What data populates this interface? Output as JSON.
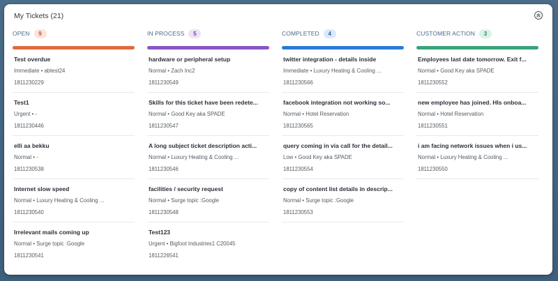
{
  "header": {
    "title": "My Tickets (21)",
    "collapse_icon": "chevron-up-circle-icon"
  },
  "colors": {
    "open": "#e06a3c",
    "in_process": "#8a55c4",
    "completed": "#2b7bd6",
    "customer_action": "#3aa37a"
  },
  "columns": [
    {
      "label": "OPEN",
      "count": "9",
      "tickets": [
        {
          "subject": "Test overdue",
          "meta": "Immediate • abtest24",
          "id": "1811230229"
        },
        {
          "subject": "Test1",
          "meta": "Urgent • -",
          "id": "1811230446"
        },
        {
          "subject": "elli aa bekku",
          "meta": "Normal • -",
          "id": "1811230538"
        },
        {
          "subject": "Internet slow speed",
          "meta": "Normal • Luxury Heating & Cooling ...",
          "id": "1811230540"
        },
        {
          "subject": "Irrelevant mails coming up",
          "meta": "Normal • Surge topic :Google",
          "id": "1811230541"
        }
      ]
    },
    {
      "label": "IN PROCESS",
      "count": "5",
      "tickets": [
        {
          "subject": "hardware or peripheral setup",
          "meta": "Normal • Zach Inc2",
          "id": "1811230549"
        },
        {
          "subject": "Skills for this ticket have been redete...",
          "meta": "Normal • Good Key aka SPADE",
          "id": "1811230547"
        },
        {
          "subject": "A long subject ticket description acti...",
          "meta": "Normal • Luxury Heating & Cooling ...",
          "id": "1811230546"
        },
        {
          "subject": "facilities / security request",
          "meta": "Normal • Surge topic :Google",
          "id": "1811230548"
        },
        {
          "subject": "Test123",
          "meta": "Urgent • Bigfoot Industries1 C20045",
          "id": "1811226541"
        }
      ]
    },
    {
      "label": "COMPLETED",
      "count": "4",
      "tickets": [
        {
          "subject": "twitter integration - details inside",
          "meta": "Immediate • Luxury Heating & Cooling ...",
          "id": "1811230566"
        },
        {
          "subject": "facebook integration not working so...",
          "meta": "Normal • Hotel Reservation",
          "id": "1811230565"
        },
        {
          "subject": "query coming in via call for the detail...",
          "meta": "Low • Good Key aka SPADE",
          "id": "1811230554"
        },
        {
          "subject": "copy of content list details in descrip...",
          "meta": "Normal • Surge topic :Google",
          "id": "1811230553"
        }
      ]
    },
    {
      "label": "CUSTOMER ACTION",
      "count": "3",
      "tickets": [
        {
          "subject": "Employees last date tomorrow. Exit f...",
          "meta": "Normal • Good Key aka SPADE",
          "id": "1811230552"
        },
        {
          "subject": "new employee has joined. HIs onboa...",
          "meta": "Normal • Hotel Reservation",
          "id": "1811230551"
        },
        {
          "subject": "i am facing network issues when i us...",
          "meta": "Normal • Luxury Heating & Cooling ...",
          "id": "1811230550"
        }
      ]
    }
  ]
}
